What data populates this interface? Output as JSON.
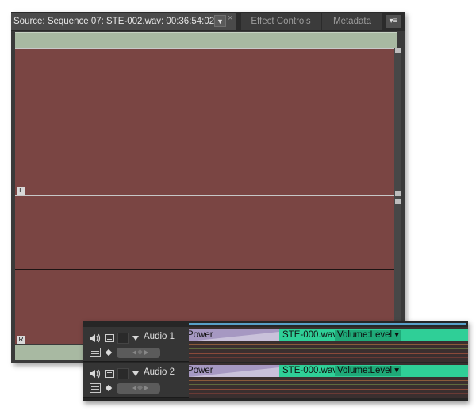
{
  "source_panel": {
    "active_tab": "Source: Sequence 07: STE-002.wav: 00:36:54:02",
    "dropdown_glyph": "▼",
    "close_glyph": "×",
    "tabs": [
      "Effect Controls",
      "Metadata"
    ],
    "menu_glyph": "▾≡",
    "channel_left": "L",
    "channel_right": "R",
    "waveform_color": "#7a4543",
    "ruler_color": "#a8b9a2"
  },
  "timeline": {
    "tracks": [
      {
        "name": "Audio 1",
        "clip_before": "Power",
        "clip_name": "STE-000.wav",
        "clip_effect": "Volume:Level ▾"
      },
      {
        "name": "Audio 2",
        "clip_before": "Power",
        "clip_name": "STE-000.wav",
        "clip_effect": "Volume:Level ▾"
      }
    ],
    "clip_color": "#2fcf97",
    "accent_line_color": "#58a0c9"
  }
}
